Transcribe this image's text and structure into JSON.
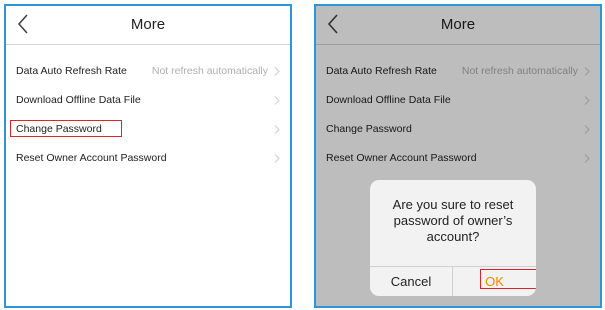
{
  "header": {
    "title": "More"
  },
  "settings": {
    "items": [
      {
        "label": "Data Auto Refresh Rate",
        "value": "Not refresh automatically"
      },
      {
        "label": "Download Offline Data File",
        "value": ""
      },
      {
        "label": "Change Password",
        "value": ""
      },
      {
        "label": "Reset Owner Account Password",
        "value": ""
      }
    ]
  },
  "dialog": {
    "message": "Are you sure to reset password of owner’s account?",
    "cancel_label": "Cancel",
    "ok_label": "OK"
  },
  "colors": {
    "frame_border": "#2a97d6",
    "highlight_box": "#d9262b",
    "ok_text": "#f08a00",
    "value_text": "#b0b0b0"
  },
  "icons": [
    "back-arrow-icon",
    "chevron-right-icon"
  ]
}
